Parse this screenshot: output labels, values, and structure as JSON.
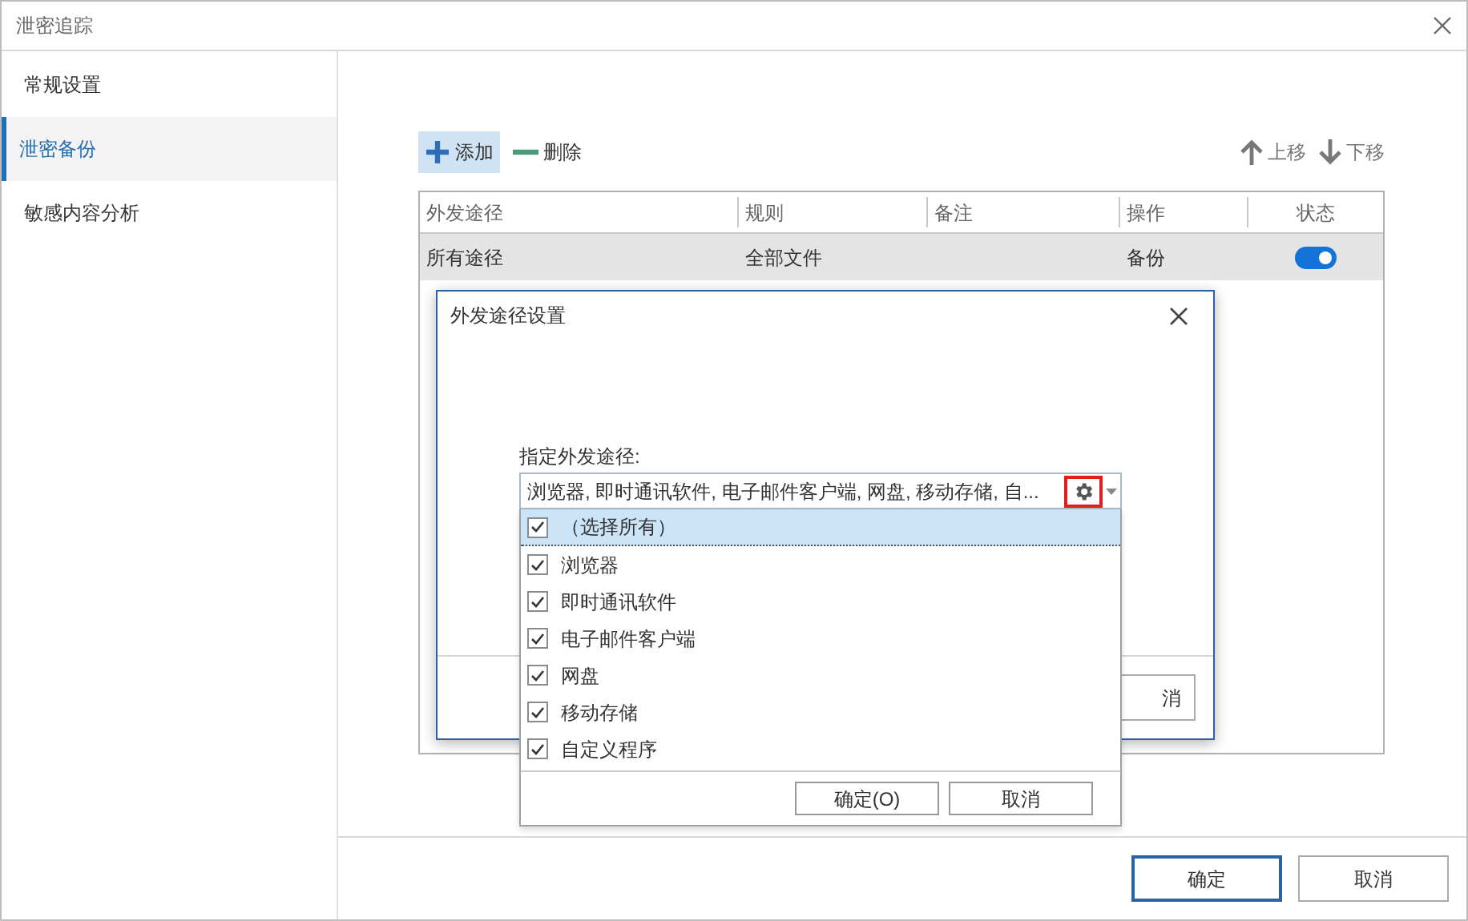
{
  "window": {
    "title": "泄密追踪"
  },
  "sidebar": {
    "items": [
      {
        "label": "常规设置",
        "selected": false
      },
      {
        "label": "泄密备份",
        "selected": true
      },
      {
        "label": "敏感内容分析",
        "selected": false
      }
    ]
  },
  "toolbar": {
    "left": [
      {
        "label": "添加",
        "kind": "add",
        "selected": true
      },
      {
        "label": "删除",
        "kind": "remove",
        "selected": false
      }
    ],
    "right": [
      {
        "label": "上移",
        "kind": "up"
      },
      {
        "label": "下移",
        "kind": "down"
      }
    ]
  },
  "table": {
    "columns": [
      "外发途径",
      "规则",
      "备注",
      "操作",
      "状态"
    ],
    "rows": [
      {
        "route": "所有途径",
        "rule": "全部文件",
        "action": "备份",
        "on": true,
        "selected": true
      }
    ]
  },
  "dialog": {
    "title": "外发途径设置",
    "cancel_button": "消"
  },
  "dropdown": {
    "label": "指定外发途径:",
    "value": "浏览器, 即时通讯软件, 电子邮件客户端, 网盘, 移动存储, 自...",
    "options": [
      {
        "label": "（选择所有）",
        "checked": true,
        "selected": true
      },
      {
        "label": "浏览器",
        "checked": true,
        "selected": false
      },
      {
        "label": "即时通讯软件",
        "checked": true,
        "selected": false
      },
      {
        "label": "电子邮件客户端",
        "checked": true,
        "selected": false
      },
      {
        "label": "网盘",
        "checked": true,
        "selected": false
      },
      {
        "label": "移动存储",
        "checked": true,
        "selected": false
      },
      {
        "label": "自定义程序",
        "checked": true,
        "selected": false
      }
    ],
    "ok_button": "确定(O)",
    "cancel_button": "取消"
  },
  "footer": {
    "buttons": [
      {
        "label": "确定",
        "kind": "primary"
      },
      {
        "label": "取消",
        "kind": "secondary"
      }
    ]
  }
}
